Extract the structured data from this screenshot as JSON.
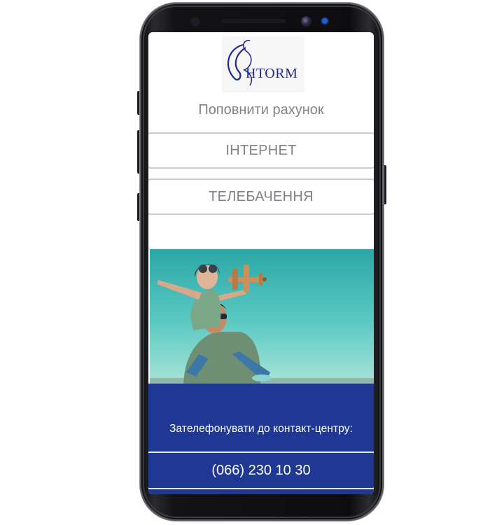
{
  "brand": {
    "logo_text": "HTORM"
  },
  "topup": {
    "title": "Поповнити рахунок"
  },
  "menu": {
    "internet_label": "ІНТЕРНЕТ",
    "tv_label": "ТЕЛЕБАЧЕННЯ"
  },
  "contact": {
    "label": "Зателефонувати до контакт-центру:",
    "phone": "(066) 230 10 30"
  },
  "colors": {
    "brand_blue": "#1e3893",
    "logo_blue": "#1f2a8a",
    "button_text": "#7f8387",
    "sky": "#4fc3c0"
  }
}
